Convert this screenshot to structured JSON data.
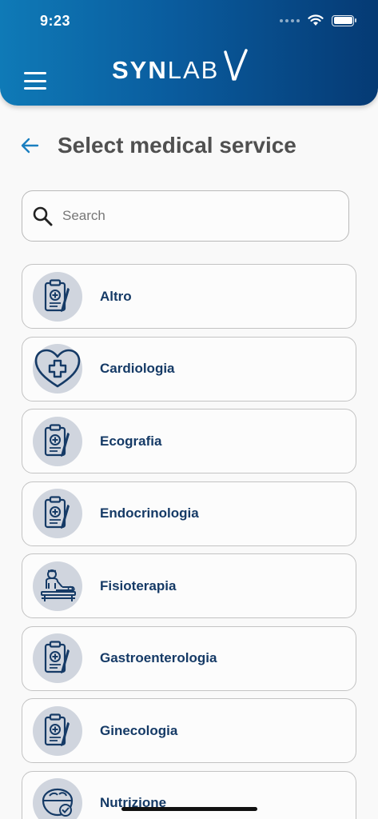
{
  "status_bar": {
    "time": "9:23"
  },
  "header": {
    "logo_bold": "SYN",
    "logo_light": "LAB"
  },
  "page": {
    "title": "Select medical service"
  },
  "search": {
    "placeholder": "Search",
    "value": ""
  },
  "services": [
    {
      "label": "Altro",
      "icon": "clipboard-medical-icon"
    },
    {
      "label": "Cardiologia",
      "icon": "heart-cross-icon"
    },
    {
      "label": "Ecografia",
      "icon": "clipboard-medical-icon"
    },
    {
      "label": "Endocrinologia",
      "icon": "clipboard-medical-icon"
    },
    {
      "label": "Fisioterapia",
      "icon": "physiotherapy-icon"
    },
    {
      "label": "Gastroenterologia",
      "icon": "clipboard-medical-icon"
    },
    {
      "label": "Ginecologia",
      "icon": "clipboard-medical-icon"
    },
    {
      "label": "Nutrizione",
      "icon": "nutrition-icon"
    }
  ],
  "colors": {
    "header_start": "#0f7ab7",
    "header_end": "#053a74",
    "accent": "#1a7fc0",
    "label": "#153a66"
  }
}
